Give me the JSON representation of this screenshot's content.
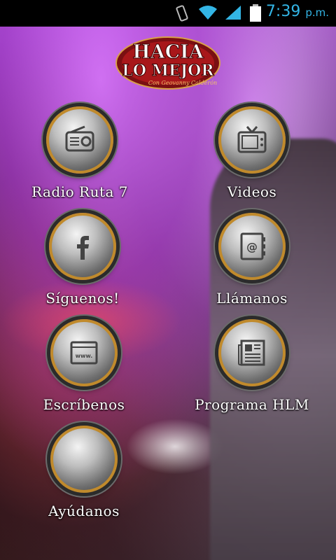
{
  "status_bar": {
    "time": "7:39",
    "ampm": "p.m.",
    "icons": [
      "vibrate-icon",
      "wifi-icon",
      "signal-icon",
      "battery-icon"
    ],
    "accent_color": "#33b5e5"
  },
  "logo": {
    "line1": "HACIA",
    "line2": "LO MEJOR",
    "tagline": "Con Geovanny Calderón"
  },
  "menu": {
    "radio_label": "Radio Ruta 7",
    "videos_label": "Videos",
    "follow_label": "Síguenos!",
    "call_label": "Llámanos",
    "write_label": "Escríbenos",
    "program_label": "Programa HLM",
    "help_label": "Ayúdanos"
  },
  "colors": {
    "knob_ring": "#c08a2c",
    "label": "#ffffff"
  }
}
